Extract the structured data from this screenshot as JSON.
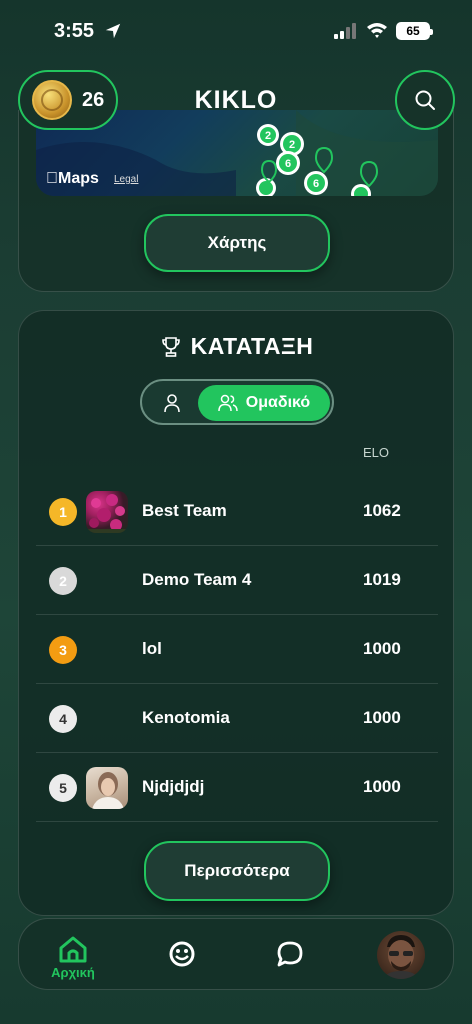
{
  "status_bar": {
    "time": "3:55",
    "battery": "65"
  },
  "header": {
    "coin_count": "26",
    "title": "KIKLO"
  },
  "map": {
    "maps_label": "Maps",
    "legal_label": "Legal",
    "button_label": "Χάρτης"
  },
  "ranking": {
    "title": "ΚΑΤΑΤΑΞΗ",
    "toggle_team_label": "Ομαδικό",
    "elo_header": "ELO",
    "rows": [
      {
        "rank": "1",
        "name": "Best Team",
        "elo": "1062",
        "badge_color": "#f5b728",
        "avatar": "flowers"
      },
      {
        "rank": "2",
        "name": "Demo Team 4",
        "elo": "1019",
        "badge_color": "#d9d9d9",
        "avatar": ""
      },
      {
        "rank": "3",
        "name": "lol",
        "elo": "1000",
        "badge_color": "#f39c12",
        "avatar": ""
      },
      {
        "rank": "4",
        "name": "Kenotomia",
        "elo": "1000",
        "badge_color": "#e6e6e6",
        "avatar": ""
      },
      {
        "rank": "5",
        "name": "Njdjdjdj",
        "elo": "1000",
        "badge_color": "#e6e6e6",
        "avatar": "person"
      }
    ],
    "more_label": "Περισσότερα"
  },
  "nav": {
    "home_label": "Αρχική"
  },
  "colors": {
    "accent": "#22c55e",
    "background": "#1b3d33"
  }
}
